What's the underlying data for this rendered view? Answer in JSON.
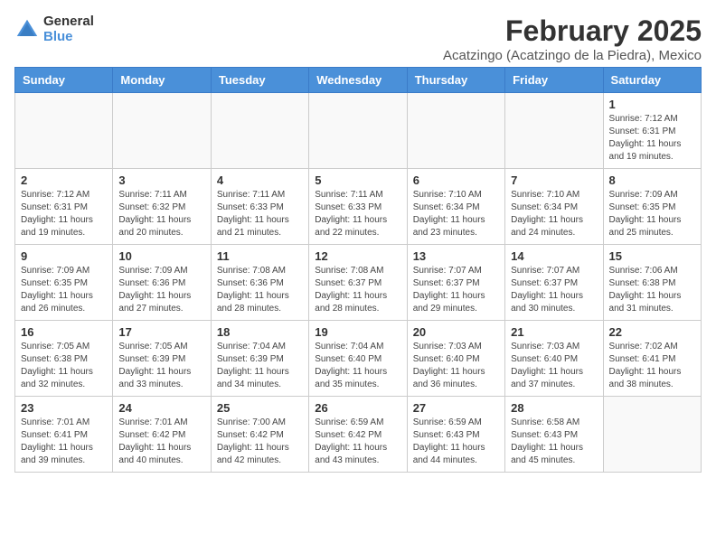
{
  "logo": {
    "general": "General",
    "blue": "Blue"
  },
  "title": "February 2025",
  "subtitle": "Acatzingo (Acatzingo de la Piedra), Mexico",
  "days_of_week": [
    "Sunday",
    "Monday",
    "Tuesday",
    "Wednesday",
    "Thursday",
    "Friday",
    "Saturday"
  ],
  "weeks": [
    [
      {
        "day": "",
        "info": ""
      },
      {
        "day": "",
        "info": ""
      },
      {
        "day": "",
        "info": ""
      },
      {
        "day": "",
        "info": ""
      },
      {
        "day": "",
        "info": ""
      },
      {
        "day": "",
        "info": ""
      },
      {
        "day": "1",
        "info": "Sunrise: 7:12 AM\nSunset: 6:31 PM\nDaylight: 11 hours and 19 minutes."
      }
    ],
    [
      {
        "day": "2",
        "info": "Sunrise: 7:12 AM\nSunset: 6:31 PM\nDaylight: 11 hours and 19 minutes."
      },
      {
        "day": "3",
        "info": "Sunrise: 7:11 AM\nSunset: 6:32 PM\nDaylight: 11 hours and 20 minutes."
      },
      {
        "day": "4",
        "info": "Sunrise: 7:11 AM\nSunset: 6:33 PM\nDaylight: 11 hours and 21 minutes."
      },
      {
        "day": "5",
        "info": "Sunrise: 7:11 AM\nSunset: 6:33 PM\nDaylight: 11 hours and 22 minutes."
      },
      {
        "day": "6",
        "info": "Sunrise: 7:10 AM\nSunset: 6:34 PM\nDaylight: 11 hours and 23 minutes."
      },
      {
        "day": "7",
        "info": "Sunrise: 7:10 AM\nSunset: 6:34 PM\nDaylight: 11 hours and 24 minutes."
      },
      {
        "day": "8",
        "info": "Sunrise: 7:09 AM\nSunset: 6:35 PM\nDaylight: 11 hours and 25 minutes."
      }
    ],
    [
      {
        "day": "9",
        "info": "Sunrise: 7:09 AM\nSunset: 6:35 PM\nDaylight: 11 hours and 26 minutes."
      },
      {
        "day": "10",
        "info": "Sunrise: 7:09 AM\nSunset: 6:36 PM\nDaylight: 11 hours and 27 minutes."
      },
      {
        "day": "11",
        "info": "Sunrise: 7:08 AM\nSunset: 6:36 PM\nDaylight: 11 hours and 28 minutes."
      },
      {
        "day": "12",
        "info": "Sunrise: 7:08 AM\nSunset: 6:37 PM\nDaylight: 11 hours and 28 minutes."
      },
      {
        "day": "13",
        "info": "Sunrise: 7:07 AM\nSunset: 6:37 PM\nDaylight: 11 hours and 29 minutes."
      },
      {
        "day": "14",
        "info": "Sunrise: 7:07 AM\nSunset: 6:37 PM\nDaylight: 11 hours and 30 minutes."
      },
      {
        "day": "15",
        "info": "Sunrise: 7:06 AM\nSunset: 6:38 PM\nDaylight: 11 hours and 31 minutes."
      }
    ],
    [
      {
        "day": "16",
        "info": "Sunrise: 7:05 AM\nSunset: 6:38 PM\nDaylight: 11 hours and 32 minutes."
      },
      {
        "day": "17",
        "info": "Sunrise: 7:05 AM\nSunset: 6:39 PM\nDaylight: 11 hours and 33 minutes."
      },
      {
        "day": "18",
        "info": "Sunrise: 7:04 AM\nSunset: 6:39 PM\nDaylight: 11 hours and 34 minutes."
      },
      {
        "day": "19",
        "info": "Sunrise: 7:04 AM\nSunset: 6:40 PM\nDaylight: 11 hours and 35 minutes."
      },
      {
        "day": "20",
        "info": "Sunrise: 7:03 AM\nSunset: 6:40 PM\nDaylight: 11 hours and 36 minutes."
      },
      {
        "day": "21",
        "info": "Sunrise: 7:03 AM\nSunset: 6:40 PM\nDaylight: 11 hours and 37 minutes."
      },
      {
        "day": "22",
        "info": "Sunrise: 7:02 AM\nSunset: 6:41 PM\nDaylight: 11 hours and 38 minutes."
      }
    ],
    [
      {
        "day": "23",
        "info": "Sunrise: 7:01 AM\nSunset: 6:41 PM\nDaylight: 11 hours and 39 minutes."
      },
      {
        "day": "24",
        "info": "Sunrise: 7:01 AM\nSunset: 6:42 PM\nDaylight: 11 hours and 40 minutes."
      },
      {
        "day": "25",
        "info": "Sunrise: 7:00 AM\nSunset: 6:42 PM\nDaylight: 11 hours and 42 minutes."
      },
      {
        "day": "26",
        "info": "Sunrise: 6:59 AM\nSunset: 6:42 PM\nDaylight: 11 hours and 43 minutes."
      },
      {
        "day": "27",
        "info": "Sunrise: 6:59 AM\nSunset: 6:43 PM\nDaylight: 11 hours and 44 minutes."
      },
      {
        "day": "28",
        "info": "Sunrise: 6:58 AM\nSunset: 6:43 PM\nDaylight: 11 hours and 45 minutes."
      },
      {
        "day": "",
        "info": ""
      }
    ]
  ]
}
